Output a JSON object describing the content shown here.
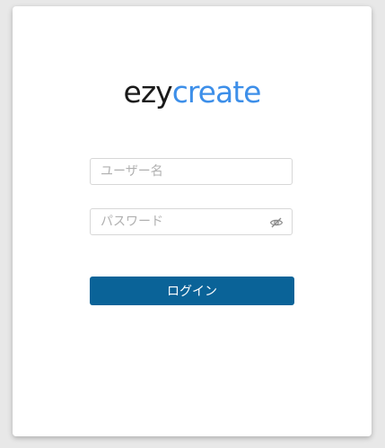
{
  "logo": {
    "part_dark": "ezy",
    "part_light": "create",
    "color_dark": "#1a1a1a",
    "color_light": "#3d8fe9"
  },
  "form": {
    "username_placeholder": "ユーザー名",
    "username_value": "",
    "password_placeholder": "パスワード",
    "password_value": "",
    "password_toggle_icon": "eye-slash-icon",
    "login_label": "ログイン",
    "login_color": "#0a6398"
  }
}
